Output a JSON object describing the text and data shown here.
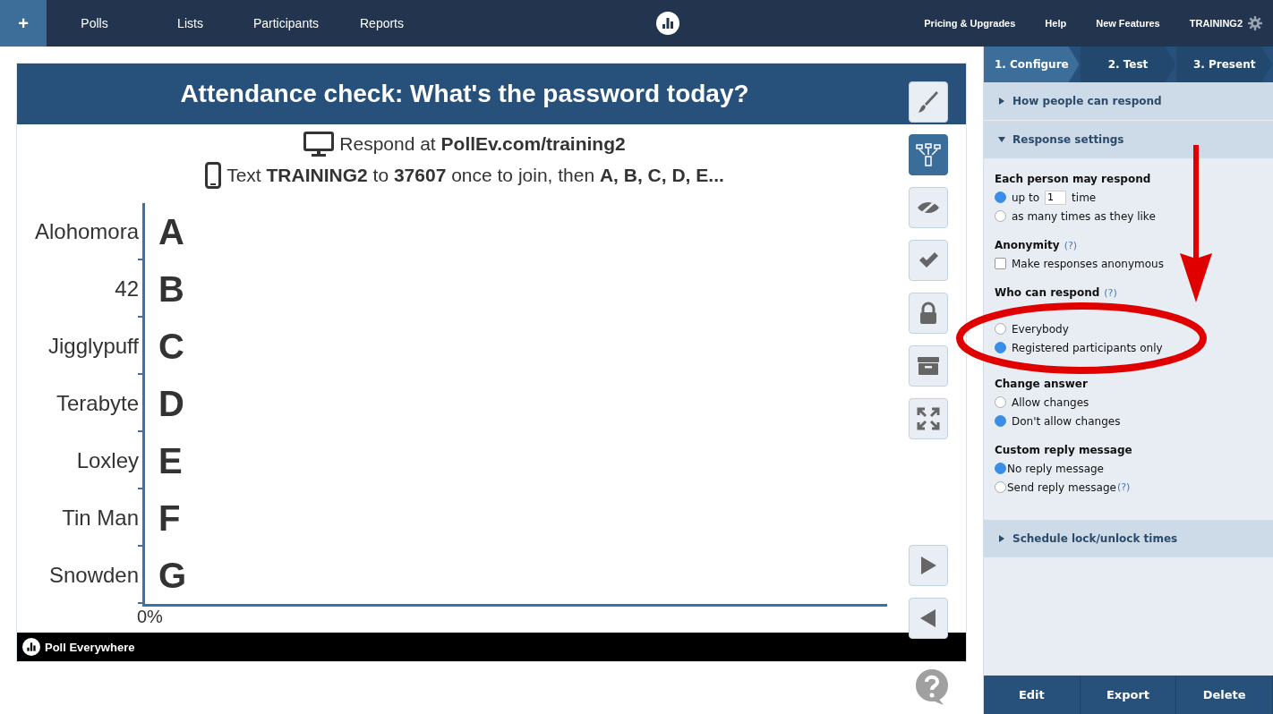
{
  "nav": {
    "add": "+",
    "items": [
      {
        "label": "Polls"
      },
      {
        "label": "Lists"
      },
      {
        "label": "Participants"
      },
      {
        "label": "Reports"
      }
    ],
    "links": [
      "Pricing & Upgrades",
      "Help",
      "New Features"
    ],
    "account": "TRAINING2"
  },
  "poll": {
    "title": "Attendance check: What's the password today?",
    "respond_web": "Respond at **PollEv.com/training2**",
    "respond_text": "Text **TRAINING2** to **37607** once to join, then  **A, B, C, D, E...**",
    "options": [
      {
        "label": "Alohomora",
        "letter": "A"
      },
      {
        "label": "42",
        "letter": "B"
      },
      {
        "label": "Jigglypuff",
        "letter": "C"
      },
      {
        "label": "Terabyte",
        "letter": "D"
      },
      {
        "label": "Loxley",
        "letter": "E"
      },
      {
        "label": "Tin Man",
        "letter": "F"
      },
      {
        "label": "Snowden",
        "letter": "G"
      }
    ],
    "axis_label": "0%",
    "brand": "Poll Everywhere"
  },
  "toolbar": [
    {
      "kind": "brush",
      "on": false
    },
    {
      "kind": "devices",
      "on": true
    },
    {
      "kind": "hide",
      "on": false
    },
    {
      "kind": "check",
      "on": false
    },
    {
      "kind": "lock",
      "on": false
    },
    {
      "kind": "archive",
      "on": false
    },
    {
      "kind": "expand",
      "on": false
    }
  ],
  "nav_buttons": [
    {
      "kind": "next"
    },
    {
      "kind": "prev"
    }
  ],
  "steps": [
    {
      "label": "1. Configure",
      "selected": true
    },
    {
      "label": "2. Test",
      "selected": false
    },
    {
      "label": "3. Present",
      "selected": false
    }
  ],
  "sections": [
    {
      "title": "How people can respond",
      "expanded": false
    },
    {
      "title": "Response settings",
      "expanded": true,
      "groups": [
        {
          "title": "Each person may respond",
          "options": [
            {
              "kind": "count",
              "label": "up to",
              "value": "1",
              "suffix": "time",
              "selected": true
            },
            {
              "kind": "radio",
              "label": "as many times as they like",
              "selected": false
            }
          ]
        },
        {
          "title": "Anonymity",
          "help": "(?)",
          "options": [
            {
              "kind": "checkbox",
              "label": "Make responses anonymous",
              "checked": false
            }
          ]
        },
        {
          "title": "Who can respond",
          "help": "(?)",
          "circled": true,
          "options": [
            {
              "kind": "radio",
              "label": "Everybody",
              "selected": false
            },
            {
              "kind": "radio",
              "label": "Registered participants only",
              "selected": true
            }
          ]
        },
        {
          "title": "Change answer",
          "options": [
            {
              "kind": "radio",
              "label": "Allow changes",
              "selected": false
            },
            {
              "kind": "radio",
              "label": "Don't allow changes",
              "selected": true
            }
          ]
        },
        {
          "title": "Custom reply message",
          "options": [
            {
              "kind": "radio",
              "label": "No reply message",
              "selected": true
            },
            {
              "kind": "radio",
              "label": "Send reply message",
              "help": "(?)",
              "selected": false
            }
          ]
        }
      ]
    },
    {
      "title": "Schedule lock/unlock times",
      "expanded": false
    }
  ],
  "actions": [
    "Edit",
    "Export",
    "Delete"
  ]
}
